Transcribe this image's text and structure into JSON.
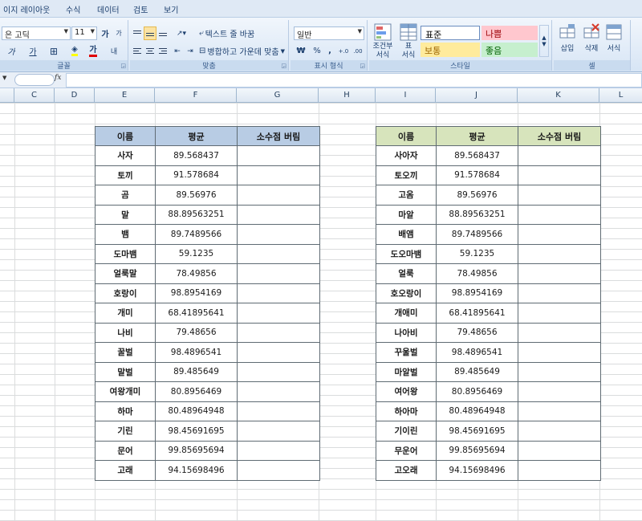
{
  "ribbon": {
    "tabs": [
      "이지 레이아웃",
      "수식",
      "데이터",
      "검토",
      "보기"
    ],
    "font": {
      "name": "은 고딕",
      "size": "11",
      "grow_label": "가",
      "shrink_label": "가",
      "italic_label": "가",
      "underline_label": "가",
      "fontcolor_label": "가",
      "phonetic_label": "내",
      "group_label": "글꼴"
    },
    "alignment": {
      "wrap_label": "텍스트 줄 바꿈",
      "merge_label": "병합하고 가운데 맞춤",
      "group_label": "맞춤"
    },
    "number": {
      "format": "일반",
      "currency_label": "₩",
      "percent_label": "%",
      "comma_label": ",",
      "inc_decimal_label": "+.0",
      "dec_decimal_label": ".00",
      "group_label": "표시 형식"
    },
    "styles": {
      "conditional_label_1": "조건부",
      "conditional_label_2": "서식",
      "table_label_1": "표",
      "table_label_2": "서식",
      "normal": "표준",
      "bad": "나쁨",
      "neutral": "보통",
      "good": "좋음",
      "group_label": "스타일"
    },
    "cells": {
      "insert_label": "삽입",
      "delete_label": "삭제",
      "format_label": "서식",
      "group_label": "셀"
    }
  },
  "formula_bar": {
    "fx_label": "fx",
    "namebox_value": "",
    "formula_value": ""
  },
  "columns": [
    "C",
    "D",
    "E",
    "F",
    "G",
    "H",
    "I",
    "J",
    "K",
    "L"
  ],
  "colors": {
    "left_header_bg": "#b8cce4",
    "right_header_bg": "#d7e4bc"
  },
  "table_left": {
    "headers": [
      "이름",
      "평균",
      "소수점 버림"
    ],
    "rows": [
      [
        "사자",
        "89.568437",
        ""
      ],
      [
        "토끼",
        "91.578684",
        ""
      ],
      [
        "곰",
        "89.56976",
        ""
      ],
      [
        "말",
        "88.89563251",
        ""
      ],
      [
        "뱀",
        "89.7489566",
        ""
      ],
      [
        "도마뱀",
        "59.1235",
        ""
      ],
      [
        "얼룩말",
        "78.49856",
        ""
      ],
      [
        "호랑이",
        "98.8954169",
        ""
      ],
      [
        "개미",
        "68.41895641",
        ""
      ],
      [
        "나비",
        "79.48656",
        ""
      ],
      [
        "꿀벌",
        "98.4896541",
        ""
      ],
      [
        "말벌",
        "89.485649",
        ""
      ],
      [
        "여왕개미",
        "80.8956469",
        ""
      ],
      [
        "하마",
        "80.48964948",
        ""
      ],
      [
        "기린",
        "98.45691695",
        ""
      ],
      [
        "문어",
        "99.85695694",
        ""
      ],
      [
        "고래",
        "94.15698496",
        ""
      ]
    ]
  },
  "table_right": {
    "headers": [
      "이름",
      "평균",
      "소수점 버림"
    ],
    "rows": [
      [
        "사아자",
        "89.568437",
        ""
      ],
      [
        "토오끼",
        "91.578684",
        ""
      ],
      [
        "고옴",
        "89.56976",
        ""
      ],
      [
        "마알",
        "88.89563251",
        ""
      ],
      [
        "배앰",
        "89.7489566",
        ""
      ],
      [
        "도오마뱀",
        "59.1235",
        ""
      ],
      [
        "얼룩",
        "78.49856",
        ""
      ],
      [
        "호오랑이",
        "98.8954169",
        ""
      ],
      [
        "개애미",
        "68.41895641",
        ""
      ],
      [
        "나아비",
        "79.48656",
        ""
      ],
      [
        "꾸울벌",
        "98.4896541",
        ""
      ],
      [
        "마알벌",
        "89.485649",
        ""
      ],
      [
        "여어왕",
        "80.8956469",
        ""
      ],
      [
        "하아마",
        "80.48964948",
        ""
      ],
      [
        "기이린",
        "98.45691695",
        ""
      ],
      [
        "무운어",
        "99.85695694",
        ""
      ],
      [
        "고오래",
        "94.15698496",
        ""
      ]
    ]
  }
}
